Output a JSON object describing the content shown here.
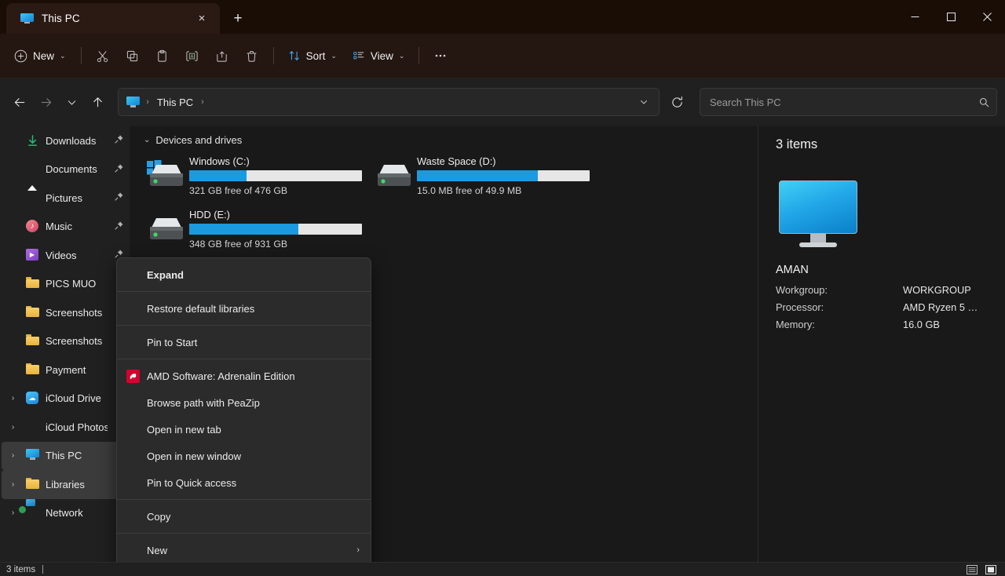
{
  "window": {
    "tab_title": "This PC",
    "close_tab_label": "×",
    "new_tab_label": "+",
    "minimize_label": "Minimize",
    "maximize_label": "Maximize",
    "close_label": "Close"
  },
  "toolbar": {
    "new_label": "New",
    "sort_label": "Sort",
    "view_label": "View",
    "more_label": "…",
    "cut_label": "Cut",
    "copy_label": "Copy",
    "paste_label": "Paste",
    "rename_label": "Rename",
    "share_label": "Share",
    "delete_label": "Delete"
  },
  "navbar": {
    "back_label": "←",
    "forward_label": "→",
    "recent_label": "⌄",
    "up_label": "↑",
    "breadcrumbs": [
      "This PC"
    ],
    "crumb_separator": "›",
    "address_dropdown_label": "⌄",
    "refresh_label": "Refresh"
  },
  "search": {
    "placeholder": "Search This PC",
    "value": ""
  },
  "sidebar": {
    "items": [
      {
        "label": "Downloads",
        "icon": "downloads-icon",
        "pinned": true,
        "arrow": false,
        "selected": false
      },
      {
        "label": "Documents",
        "icon": "documents-icon",
        "pinned": true,
        "arrow": false,
        "selected": false
      },
      {
        "label": "Pictures",
        "icon": "pictures-icon",
        "pinned": true,
        "arrow": false,
        "selected": false
      },
      {
        "label": "Music",
        "icon": "music-icon",
        "pinned": true,
        "arrow": false,
        "selected": false
      },
      {
        "label": "Videos",
        "icon": "videos-icon",
        "pinned": true,
        "arrow": false,
        "selected": false
      },
      {
        "label": "PICS MUO",
        "icon": "folder-icon",
        "pinned": false,
        "arrow": false,
        "selected": false
      },
      {
        "label": "Screenshots",
        "icon": "folder-icon",
        "pinned": false,
        "arrow": false,
        "selected": false
      },
      {
        "label": "Screenshots",
        "icon": "folder-icon",
        "pinned": false,
        "arrow": false,
        "selected": false
      },
      {
        "label": "Payment",
        "icon": "folder-icon",
        "pinned": false,
        "arrow": false,
        "selected": false
      },
      {
        "label": "iCloud Drive",
        "icon": "icloud-drive-icon",
        "pinned": false,
        "arrow": true,
        "selected": false
      },
      {
        "label": "iCloud Photos",
        "icon": "icloud-photos-icon",
        "pinned": false,
        "arrow": true,
        "selected": false
      },
      {
        "label": "This PC",
        "icon": "this-pc-icon",
        "pinned": false,
        "arrow": true,
        "selected": true
      },
      {
        "label": "Libraries",
        "icon": "folder-icon",
        "pinned": false,
        "arrow": true,
        "selected": true
      },
      {
        "label": "Network",
        "icon": "network-icon",
        "pinned": false,
        "arrow": true,
        "selected": false
      }
    ],
    "expand_arrow": "›",
    "pin_glyph": "📌"
  },
  "main": {
    "group_title": "Devices and drives",
    "group_chevron": "⌄",
    "drives": [
      {
        "name": "Windows (C:)",
        "free_text": "321 GB free of 476 GB",
        "free_gb": 321,
        "total_gb": 476,
        "used_percent": 33,
        "icon": "windows-drive-icon"
      },
      {
        "name": "Waste Space (D:)",
        "free_text": "15.0 MB free of 49.9 MB",
        "free_gb": 0.0146,
        "total_gb": 0.0487,
        "used_percent": 70,
        "icon": "drive-icon"
      },
      {
        "name": "HDD (E:)",
        "free_text": "348 GB free of 931 GB",
        "free_gb": 348,
        "total_gb": 931,
        "used_percent": 63,
        "icon": "drive-icon"
      }
    ]
  },
  "details": {
    "item_count": "3 items",
    "device_name": "AMAN",
    "icon": "monitor-icon",
    "rows": [
      {
        "key": "Workgroup:",
        "value": "WORKGROUP"
      },
      {
        "key": "Processor:",
        "value": "AMD Ryzen 5 …"
      },
      {
        "key": "Memory:",
        "value": "16.0 GB"
      }
    ]
  },
  "context_menu": {
    "groups": [
      [
        {
          "label": "Expand",
          "bold": true,
          "icon": null,
          "submenu": false
        }
      ],
      [
        {
          "label": "Restore default libraries",
          "bold": false,
          "icon": null,
          "submenu": false
        }
      ],
      [
        {
          "label": "Pin to Start",
          "bold": false,
          "icon": null,
          "submenu": false
        }
      ],
      [
        {
          "label": "AMD Software: Adrenalin Edition",
          "bold": false,
          "icon": "amd-icon",
          "submenu": false
        },
        {
          "label": "Browse path with PeaZip",
          "bold": false,
          "icon": null,
          "submenu": false
        },
        {
          "label": "Open in new tab",
          "bold": false,
          "icon": null,
          "submenu": false
        },
        {
          "label": "Open in new window",
          "bold": false,
          "icon": null,
          "submenu": false
        },
        {
          "label": "Pin to Quick access",
          "bold": false,
          "icon": null,
          "submenu": false
        }
      ],
      [
        {
          "label": "Copy",
          "bold": false,
          "icon": null,
          "submenu": false
        }
      ],
      [
        {
          "label": "New",
          "bold": false,
          "icon": null,
          "submenu": true
        }
      ]
    ],
    "submenu_arrow": "›"
  },
  "statusbar": {
    "item_count": "3 items",
    "details_view_label": "Details view",
    "large_icons_view_label": "Large icons view"
  },
  "colors": {
    "accent": "#1b9ae0",
    "titlebar_bg": "#190d06",
    "tab_bg": "#2b1a14",
    "cmdbar_bg": "#241611",
    "chrome_bg": "#202020",
    "content_bg": "#191919",
    "menu_bg": "#2b2b2b",
    "amd_red": "#d6002f",
    "selection": "#3b3b3b"
  }
}
